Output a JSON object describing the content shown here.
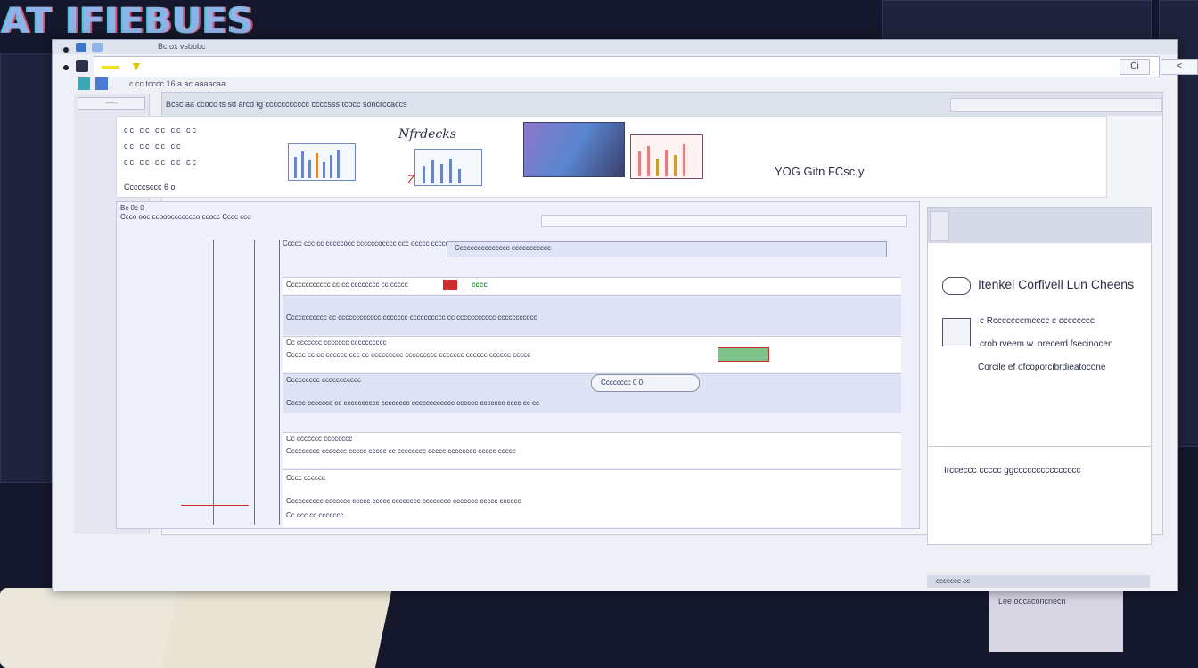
{
  "background": {
    "logo_text": "AT IFIEBUES",
    "desk_sticker_text": "Lee oocaconcnecn"
  },
  "window": {
    "title_text": "Bc ox vsbbbc",
    "address": {
      "value": "",
      "btn_1": "Ci",
      "btn_2": "<"
    },
    "toolbar_text": "c cc tcccc 16 a ac aaaacaa",
    "sidebar": {
      "head": "-----"
    },
    "content": {
      "header": "Bcsc aa ccocc ts sd arcd tg ccccccccccc ccccsss tcocc soncrccaccs",
      "banner": {
        "handwritten_title": "Nfrdecks",
        "dot_rows": [
          "cc cc cc cc cc",
          "cc cc cc cc",
          "cc cc cc cc cc"
        ],
        "handwritten_note": "YOG Gitn FCsc,y",
        "caption": "Cccccsccc 6 o"
      },
      "grid": {
        "head_1": "Bc 0c 0",
        "head_2": "Ccco ooc ccoooccccccco ccocc  Cccc cco",
        "header_row": "Ccccc ccc cc cccccocc ccccccocccc ccc occcc ccccc cccoccc ccc ccocccc ccccccc ccccco",
        "highlight_row": "Ccccccccccccccc ccccccccccc",
        "rows": [
          {
            "line1": "Cccccccccccc cc cc cccccccc cc  ccccc",
            "tag": "cccc",
            "line2": ""
          },
          {
            "line1": "Ccccccccccc cc cccccccccccc ccccccc cccccccccc cc ccccccccccc ccccccccccc",
            "tag": "",
            "line2": ""
          },
          {
            "line1": "Cc ccccccc ccccccc cccccccccc",
            "tag": "",
            "line2": "Ccccc cc cc cccccc ccc cc ccccccccc ccccccccc ccccccc cccccc cccccc ccccc"
          },
          {
            "line1": "Ccccccccc ccccccccccc",
            "tag": "Cccccccc 0 0",
            "line2": "Ccccc ccccccc cc cccccccccc cccccccc cccccccccccc cccccc ccccccc cccc cc cc"
          },
          {
            "line1": "Cc ccccccc cccccccc",
            "tag": "",
            "line2": "Ccccccccc ccccccc ccccc ccccc cc cccccccc ccccc cccccccc ccccc ccccc"
          },
          {
            "line1": "Cccc cccccc",
            "tag": "",
            "line2": "Cccccccccc ccccccc ccccc ccccc cccccccc cccccccc ccccccc ccccc cccccc"
          }
        ],
        "footer_row": "Cc ccc cc ccccccc"
      }
    },
    "right_panel": {
      "title": "Itenkei Corfivell Lun Cheens",
      "line_1": "c Rcccccccmcccc c cccccccc",
      "line_2": "crob rveem w. orecerd  fsecinocen",
      "line_3": "Corcile ef ofcoporcibrdieatocone",
      "footer": "Ircceccc ccccc  ggccccccccccccccc"
    },
    "status_text": "ccccccc cc"
  },
  "colors": {
    "accent_blue": "#6a86c4",
    "highlight_yellow": "#f2e11c",
    "red_mark": "#d02b2b",
    "green_text": "#2e9a3c"
  }
}
